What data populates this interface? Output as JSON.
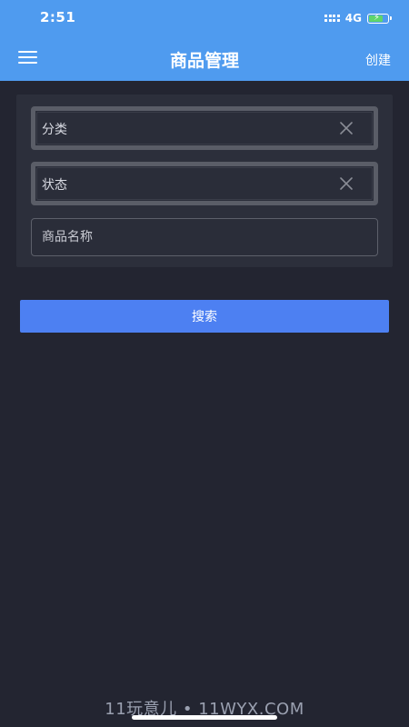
{
  "status_bar": {
    "time": "2:51",
    "network": "4G",
    "battery_level": 0.8,
    "battery_color": "#5fd56a"
  },
  "header": {
    "title": "商品管理",
    "create_label": "创建",
    "menu_icon": "hamburger-menu-icon",
    "background": "#4f9bef"
  },
  "filters": {
    "category_label": "分类",
    "status_label": "状态",
    "clear_icon": "close-icon",
    "product_name_placeholder": "商品名称",
    "product_name_value": ""
  },
  "actions": {
    "search_label": "搜索",
    "accent": "#4d80f2"
  },
  "watermark": "11玩意儿 • 11WYX.COM"
}
